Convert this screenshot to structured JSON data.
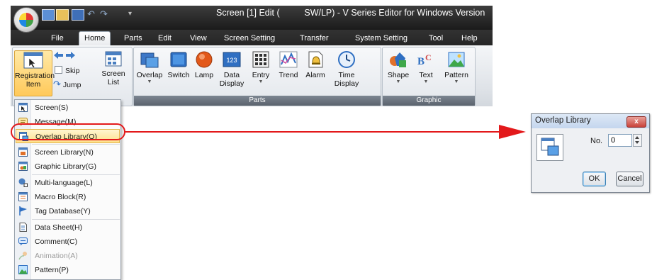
{
  "window": {
    "title": "Screen [1] Edit (          SW/LP) - V Series Editor for Windows Version"
  },
  "tabs": [
    {
      "label": "File",
      "active": false
    },
    {
      "label": "Home",
      "active": true
    },
    {
      "label": "Parts",
      "active": false
    },
    {
      "label": "Edit",
      "active": false
    },
    {
      "label": "View",
      "active": false
    },
    {
      "label": "Screen Setting",
      "active": false
    },
    {
      "label": "Transfer",
      "active": false
    },
    {
      "label": "System Setting",
      "active": false
    },
    {
      "label": "Tool",
      "active": false
    },
    {
      "label": "Help",
      "active": false
    }
  ],
  "ribbon": {
    "registration": {
      "line1": "Registration",
      "line2": "Item"
    },
    "skip": "Skip",
    "jump": "Jump",
    "screen_list": {
      "line1": "Screen",
      "line2": "List"
    },
    "parts_group": "Parts",
    "graphic_group": "Graphic",
    "parts": {
      "overlap": "Overlap",
      "switch": "Switch",
      "lamp": "Lamp",
      "data_display": {
        "line1": "Data",
        "line2": "Display"
      },
      "entry": "Entry",
      "trend": "Trend",
      "alarm": "Alarm",
      "time_display": {
        "line1": "Time",
        "line2": "Display"
      }
    },
    "graphic": {
      "shape": "Shape",
      "text": "Text",
      "pattern": "Pattern"
    }
  },
  "menu": {
    "items": [
      {
        "label": "Screen(S)",
        "icon": "screen-icon",
        "disabled": false,
        "selected": false
      },
      {
        "label": "Message(M)",
        "icon": "message-icon",
        "disabled": false,
        "selected": false
      },
      {
        "label": "Overlap Library(O)",
        "icon": "overlap-library-icon",
        "disabled": false,
        "selected": true
      },
      {
        "label": "Screen Library(N)",
        "icon": "screen-library-icon",
        "disabled": false,
        "selected": false
      },
      {
        "label": "Graphic Library(G)",
        "icon": "graphic-library-icon",
        "disabled": false,
        "selected": false
      },
      {
        "label": "Multi-language(L)",
        "icon": "multi-language-icon",
        "disabled": false,
        "selected": false
      },
      {
        "label": "Macro Block(R)",
        "icon": "macro-block-icon",
        "disabled": false,
        "selected": false
      },
      {
        "label": "Tag Database(Y)",
        "icon": "tag-database-icon",
        "disabled": false,
        "selected": false
      },
      {
        "label": "Data Sheet(H)",
        "icon": "data-sheet-icon",
        "disabled": false,
        "selected": false
      },
      {
        "label": "Comment(C)",
        "icon": "comment-icon",
        "disabled": false,
        "selected": false
      },
      {
        "label": "Animation(A)",
        "icon": "animation-icon",
        "disabled": true,
        "selected": false
      },
      {
        "label": "Pattern(P)",
        "icon": "pattern-icon",
        "disabled": false,
        "selected": false
      }
    ]
  },
  "dialog": {
    "title": "Overlap Library",
    "no_label": "No.",
    "no_value": "0",
    "ok": "OK",
    "cancel": "Cancel",
    "close": "x"
  },
  "colors": {
    "highlight": "#e3191b",
    "arrow": "#e3191b",
    "selected_item": "#ffe08a"
  }
}
